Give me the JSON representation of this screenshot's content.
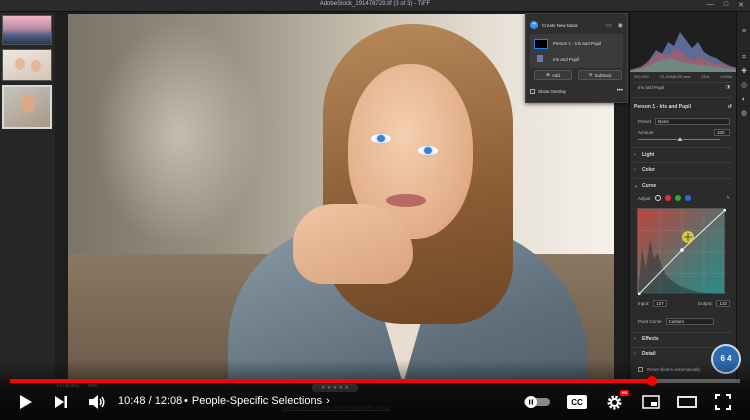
{
  "window": {
    "title": "AdobeStock_191478729.tif (3 of 3)  -  TIFF",
    "controls": [
      "—",
      "□",
      "✕"
    ]
  },
  "masks_panel": {
    "create_label": "Create New Mask",
    "mask_name": "Person 1 - Iris and Pupil",
    "component_name": "Iris and Pupil",
    "add_label": "Add",
    "subtract_label": "Subtract",
    "show_overlay_label": "Show Overlay",
    "more": "•••"
  },
  "right_panel": {
    "camera_info": [
      "ISO 250",
      "70-200@130 mm",
      "f/5.6",
      "1/200s"
    ],
    "component_label": "Iris and Pupil",
    "mask_title": "Person 1 - Iris and Pupil",
    "preset_label": "Preset",
    "preset_value": "None",
    "amount_label": "Amount",
    "amount_value": "100",
    "sections": {
      "light": "Light",
      "color": "Color",
      "curve": "Curve",
      "effects": "Effects",
      "detail": "Detail"
    },
    "adjust_label": "Adjust",
    "input_label": "Input:",
    "input_value": "127",
    "output_label": "Output:",
    "output_value": "132",
    "point_curve_label": "Point Curve",
    "point_curve_value": "Custom",
    "reset_label": "Reset sliders automatically"
  },
  "status": {
    "fit": "Fit (18.8%)",
    "zoom": "100%",
    "file_info": "Adobe RGB (1998) - 16 bit - 7360 x 4912 (36.2MP) - 300 ppi"
  },
  "badge": {
    "text": "6 4"
  },
  "player": {
    "progress_fraction": 0.88,
    "current_time": "10:48",
    "separator": " / ",
    "duration": "12:08",
    "chapter_bullet": "•",
    "chapter_title": "People-Specific Selections",
    "chapter_arrow": "›",
    "cc_label": "CC",
    "hd_label": "HD"
  },
  "colors": {
    "accent": "#2680eb",
    "progress": "#ff0000"
  }
}
